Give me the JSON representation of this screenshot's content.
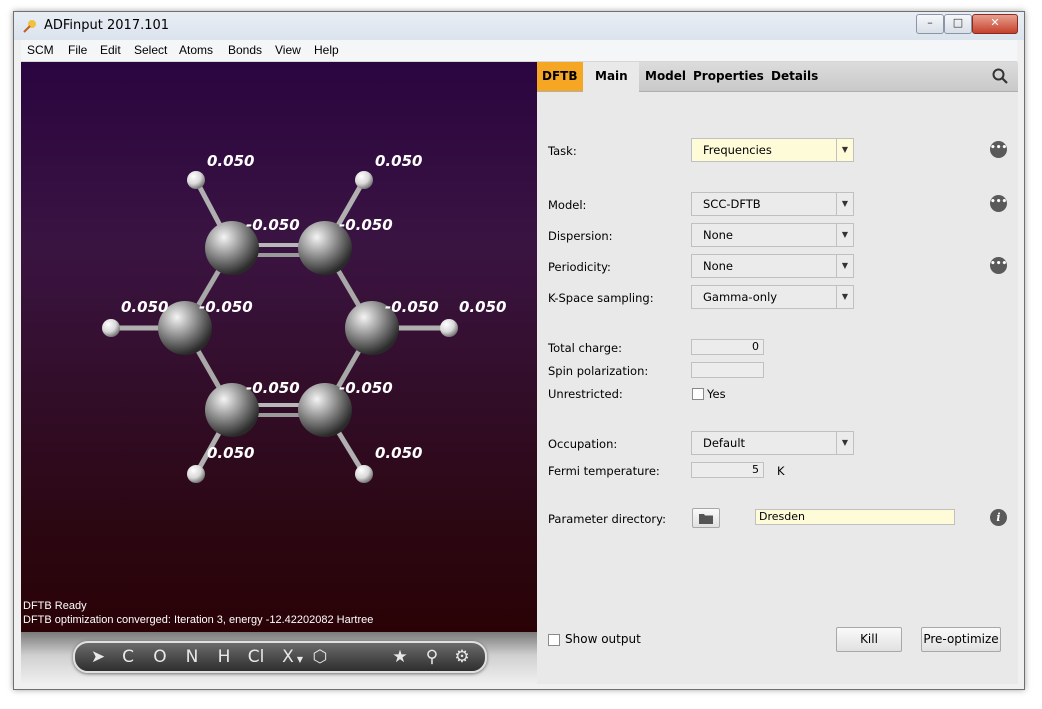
{
  "window": {
    "title": "ADFinput 2017.101"
  },
  "menu": [
    "SCM",
    "File",
    "Edit",
    "Select",
    "Atoms",
    "Bonds",
    "View",
    "Help"
  ],
  "tabs": {
    "dftb": "DFTB",
    "main": "Main",
    "model": "Model",
    "properties": "Properties",
    "details": "Details"
  },
  "form": {
    "task": {
      "label": "Task:",
      "value": "Frequencies"
    },
    "model": {
      "label": "Model:",
      "value": "SCC-DFTB"
    },
    "dispersion": {
      "label": "Dispersion:",
      "value": "None"
    },
    "periodicity": {
      "label": "Periodicity:",
      "value": "None"
    },
    "kspace": {
      "label": "K-Space sampling:",
      "value": "Gamma-only"
    },
    "total_charge": {
      "label": "Total charge:",
      "value": "0"
    },
    "spin_polarization": {
      "label": "Spin polarization:",
      "value": ""
    },
    "unrestricted": {
      "label": "Unrestricted:",
      "option": "Yes",
      "checked": false
    },
    "occupation": {
      "label": "Occupation:",
      "value": "Default"
    },
    "fermi": {
      "label": "Fermi temperature:",
      "value": "5",
      "unit": "K"
    },
    "param_dir": {
      "label": "Parameter directory:",
      "value": "Dresden"
    }
  },
  "bottom": {
    "show_output": "Show output",
    "kill": "Kill",
    "preoptimize": "Pre-optimize"
  },
  "status": {
    "line1": "DFTB Ready",
    "line2": "DFTB optimization converged: Iteration 3, energy -12.42202082 Hartree"
  },
  "molecule": {
    "carbons": [
      {
        "charge": "-0.050"
      },
      {
        "charge": "-0.050"
      },
      {
        "charge": "-0.050"
      },
      {
        "charge": "-0.050"
      },
      {
        "charge": "-0.050"
      },
      {
        "charge": "-0.050"
      }
    ],
    "hydrogens": [
      {
        "charge": "0.050"
      },
      {
        "charge": "0.050"
      },
      {
        "charge": "0.050"
      },
      {
        "charge": "0.050"
      },
      {
        "charge": "0.050"
      },
      {
        "charge": "0.050"
      }
    ]
  },
  "toolbar": [
    "C",
    "O",
    "N",
    "H",
    "Cl",
    "X"
  ],
  "colors": {
    "accent": "#f5a623",
    "highlight_field": "#fdfbd8"
  }
}
